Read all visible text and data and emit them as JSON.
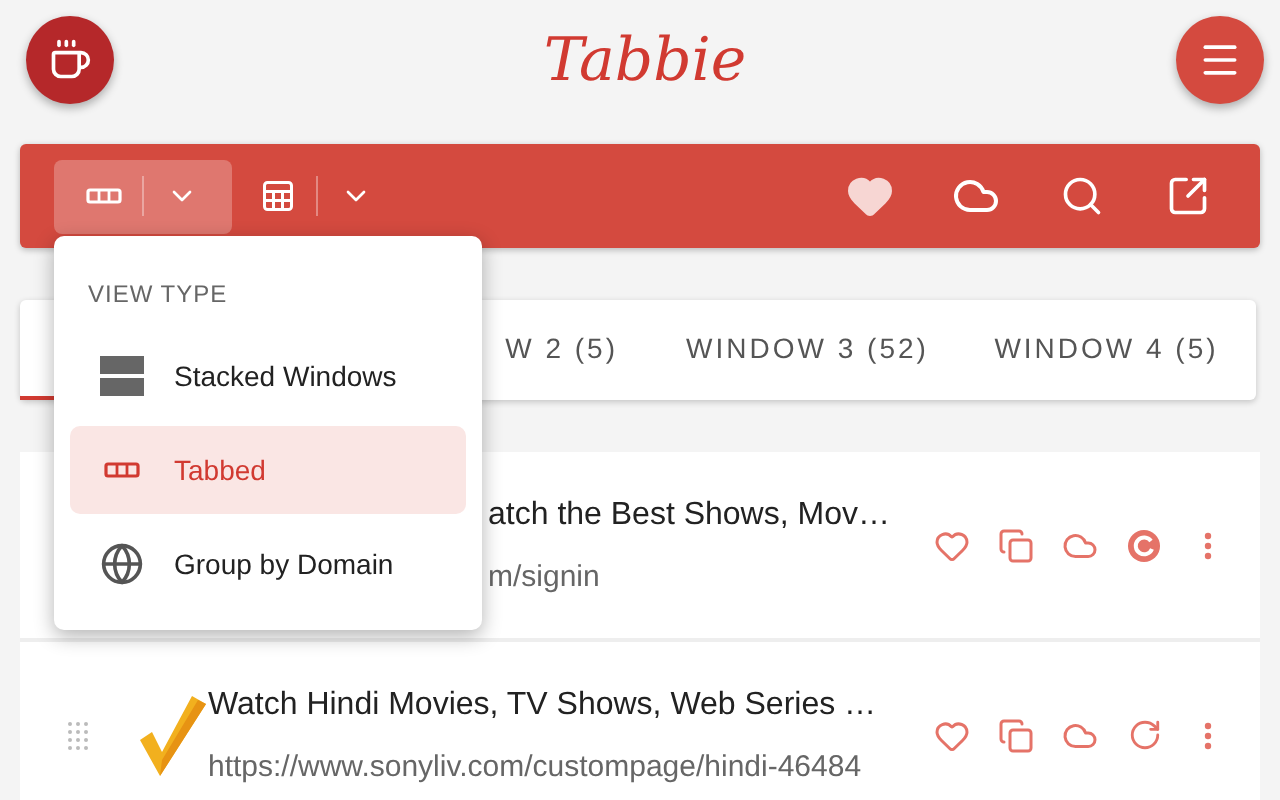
{
  "app": {
    "title": "Tabbie"
  },
  "toolbar": {
    "view_menu_open": true
  },
  "tabs": [
    {
      "selected": true
    },
    {
      "label": "W 2 (5)",
      "selected": false
    },
    {
      "label": "WINDOW 3 (52)",
      "selected": false
    },
    {
      "label": "WINDOW 4 (5)",
      "selected": false
    }
  ],
  "rows": [
    {
      "title": "atch the Best Shows, Mov…",
      "url": "m/signin",
      "partly_hidden": true,
      "reload_active": true
    },
    {
      "title": "Watch Hindi Movies, TV Shows, Web Series …",
      "url": "https://www.sonyliv.com/custompage/hindi-46484",
      "partly_hidden": false,
      "reload_active": false
    }
  ],
  "view_menu": {
    "heading": "VIEW TYPE",
    "items": [
      {
        "kind": "stacked",
        "label": "Stacked Windows",
        "selected": false
      },
      {
        "kind": "tabbed",
        "label": "Tabbed",
        "selected": true
      },
      {
        "kind": "domain",
        "label": "Group by Domain",
        "selected": false
      }
    ]
  }
}
